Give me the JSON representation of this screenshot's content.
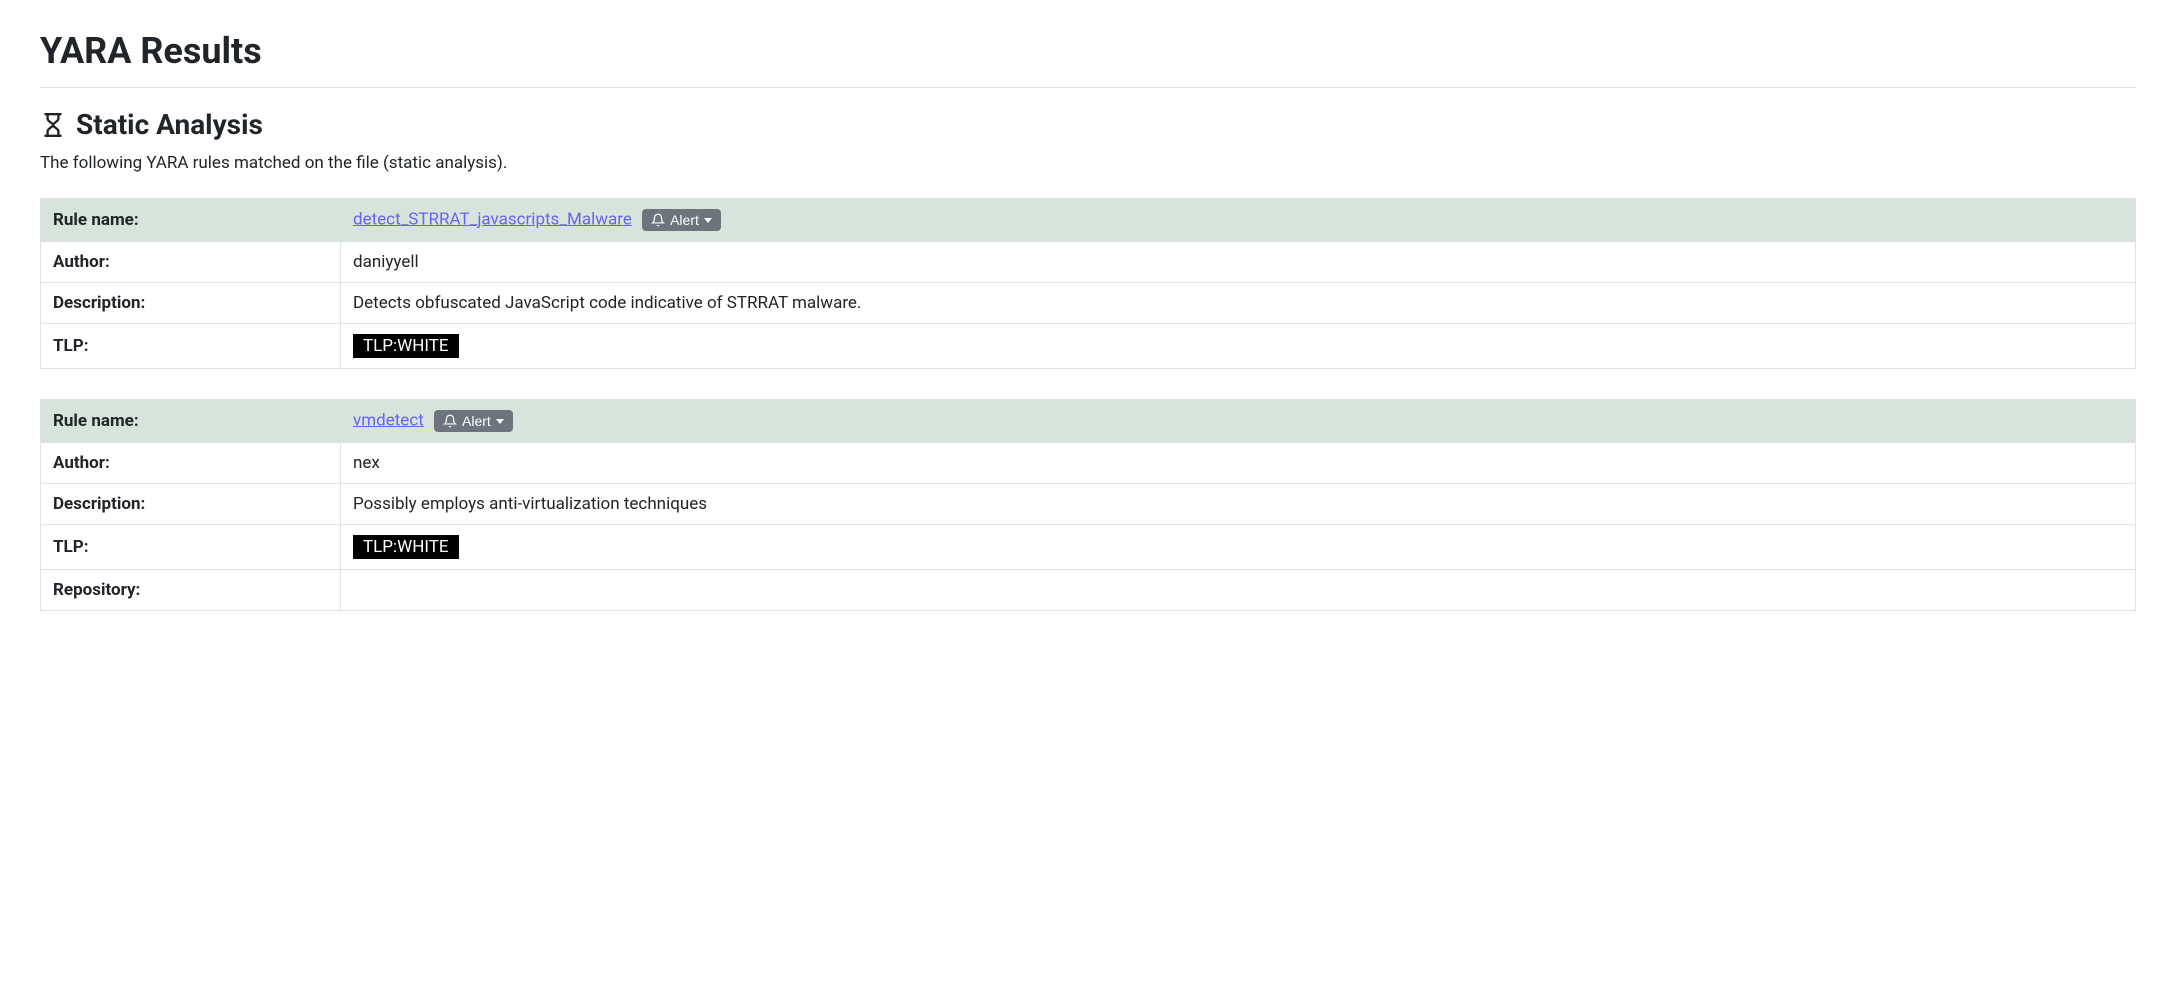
{
  "page_title": "YARA Results",
  "section": {
    "title": "Static Analysis",
    "intro": "The following YARA rules matched on the file (static analysis)."
  },
  "labels": {
    "rule_name": "Rule name:",
    "author": "Author:",
    "description": "Description:",
    "tlp": "TLP:",
    "repository": "Repository:"
  },
  "alert_button_label": "Alert",
  "rules": [
    {
      "name": "detect_STRRAT_javascripts_Malware",
      "author": "daniyyell",
      "description": "Detects obfuscated JavaScript code indicative of STRRAT malware.",
      "tlp": "TLP:WHITE"
    },
    {
      "name": "vmdetect",
      "author": "nex",
      "description": "Possibly employs anti-virtualization techniques",
      "tlp": "TLP:WHITE",
      "repository": ""
    }
  ]
}
